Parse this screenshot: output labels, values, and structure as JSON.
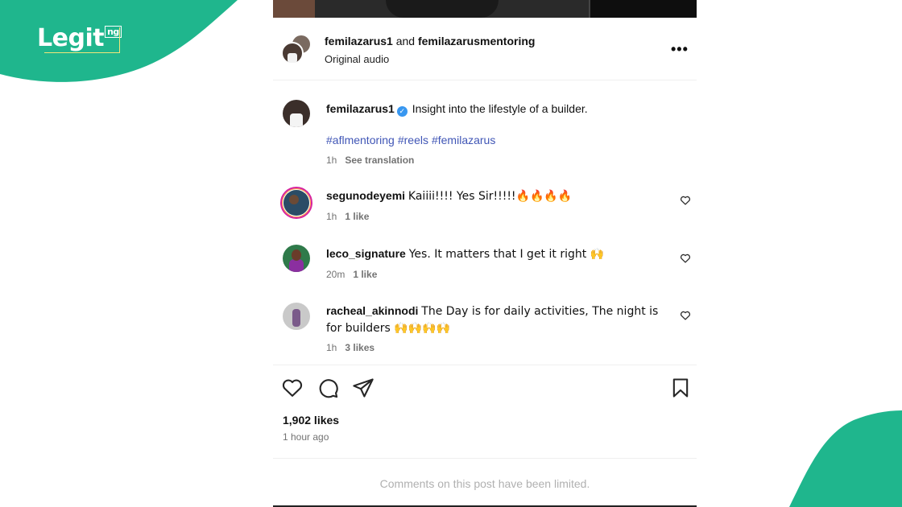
{
  "brand": {
    "logo_text": "Legit",
    "logo_suffix": "ng",
    "accent_color": "#1fb68d"
  },
  "post": {
    "header": {
      "user1": "femilazarus1",
      "joiner": "and",
      "user2": "femilazarusmentoring",
      "audio": "Original audio",
      "more_icon": "more-options-icon"
    },
    "caption": {
      "username": "femilazarus1",
      "text": "Insight into the lifestyle of a builder.",
      "hashtags": [
        "#aflmentoring",
        "#reels",
        "#femilazarus"
      ],
      "time": "1h",
      "translate": "See translation"
    },
    "comments": [
      {
        "username": "segunodeyemi",
        "text": "Kaiiii!!!! Yes Sir!!!!!🔥🔥🔥🔥",
        "time": "1h",
        "likes": "1 like"
      },
      {
        "username": "leco_signature",
        "text": "Yes. It matters that I get it right 🙌",
        "time": "20m",
        "likes": "1 like"
      },
      {
        "username": "racheal_akinnodi",
        "text": "The Day is for daily activities, The night is for builders 🙌🙌🙌🙌",
        "time": "1h",
        "likes": "3 likes"
      }
    ],
    "likes_count": "1,902 likes",
    "posted_ago": "1 hour ago",
    "comments_limited": "Comments on this post have been limited."
  }
}
